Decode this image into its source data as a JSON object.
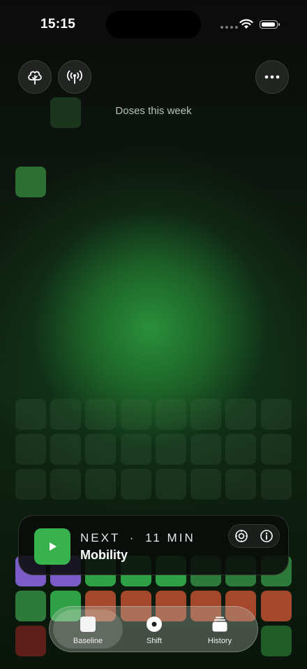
{
  "status_bar": {
    "time": "15:15"
  },
  "header": {
    "title": "Doses this week",
    "left_icons": [
      "tree-icon",
      "broadcast-icon"
    ],
    "right_icon": "more-icon"
  },
  "next_card": {
    "label": "NEXT",
    "separator": "·",
    "duration": "11 MIN",
    "name": "Mobility",
    "accent": "#38b24c",
    "actions": [
      "focus-icon",
      "info-icon"
    ]
  },
  "tabs": [
    {
      "label": "Baseline",
      "icon": "square-icon",
      "active": true
    },
    {
      "label": "Shift",
      "icon": "disc-icon",
      "active": false
    },
    {
      "label": "History",
      "icon": "stack-icon",
      "active": false
    }
  ],
  "colors": {
    "green": "#2fa045",
    "purple": "#7c5cc6",
    "orange": "#a3482a",
    "background": "#0b0d0b"
  }
}
